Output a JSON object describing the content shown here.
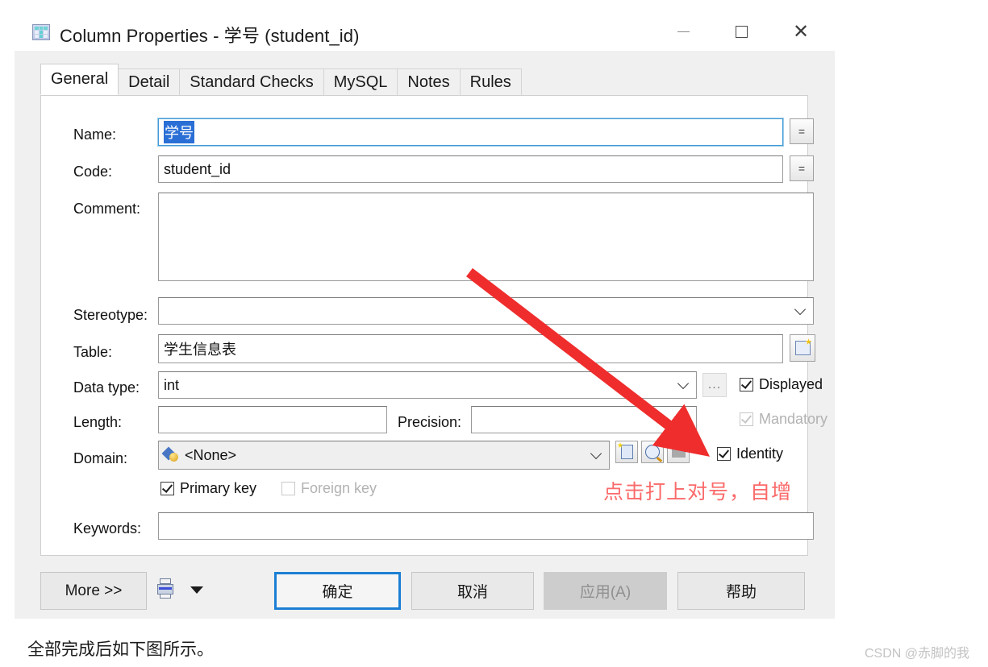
{
  "window": {
    "title": "Column Properties - 学号 (student_id)",
    "icon": "table-grid-icon",
    "minimize_label": "—",
    "maximize_label": "□",
    "close_label": "✕"
  },
  "tabs": [
    {
      "label": "General",
      "active": true
    },
    {
      "label": "Detail",
      "active": false
    },
    {
      "label": "Standard Checks",
      "active": false
    },
    {
      "label": "MySQL",
      "active": false
    },
    {
      "label": "Notes",
      "active": false
    },
    {
      "label": "Rules",
      "active": false
    }
  ],
  "form": {
    "name": {
      "label": "Name:",
      "value": "学号",
      "selected": true,
      "ellipsis_button": "="
    },
    "code": {
      "label": "Code:",
      "value": "student_id",
      "ellipsis_button": "="
    },
    "comment": {
      "label": "Comment:",
      "value": ""
    },
    "stereotype": {
      "label": "Stereotype:",
      "value": ""
    },
    "table": {
      "label": "Table:",
      "value": "学生信息表"
    },
    "data_type": {
      "label": "Data type:",
      "value": "int",
      "browse_button": "..."
    },
    "length": {
      "label": "Length:",
      "value": ""
    },
    "precision": {
      "label": "Precision:",
      "value": ""
    },
    "domain": {
      "label": "Domain:",
      "value": "<None>"
    },
    "keywords": {
      "label": "Keywords:",
      "value": ""
    }
  },
  "checkboxes": {
    "displayed": {
      "label": "Displayed",
      "checked": true,
      "enabled": true
    },
    "mandatory": {
      "label": "Mandatory",
      "checked": true,
      "enabled": false
    },
    "identity": {
      "label": "Identity",
      "checked": true,
      "enabled": true
    },
    "primary_key": {
      "label": "Primary key",
      "checked": true,
      "enabled": true
    },
    "foreign_key": {
      "label": "Foreign key",
      "checked": false,
      "enabled": false
    }
  },
  "buttons": {
    "more": "More >>",
    "ok": "确定",
    "cancel": "取消",
    "apply": "应用(A)",
    "help": "帮助"
  },
  "annotation": {
    "note": "点击打上对号，自增",
    "color": "#fb6a6a"
  },
  "page": {
    "caption": "全部完成后如下图所示。",
    "watermark": "CSDN @赤脚的我"
  }
}
